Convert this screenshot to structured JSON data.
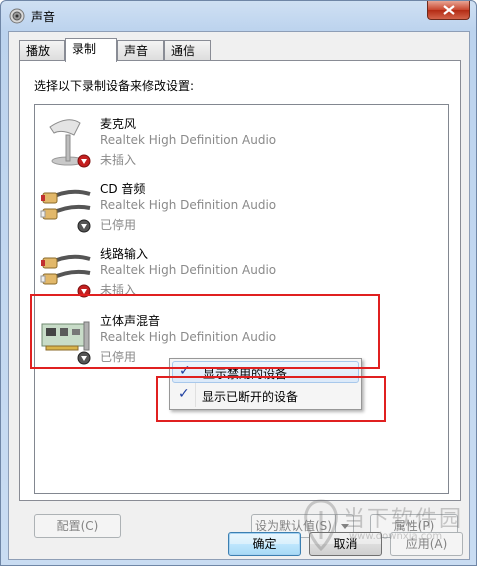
{
  "window": {
    "title": "声音"
  },
  "tabs": [
    {
      "label": "播放"
    },
    {
      "label": "录制"
    },
    {
      "label": "声音"
    },
    {
      "label": "通信"
    }
  ],
  "instruction": "选择以下录制设备来修改设置:",
  "devices": [
    {
      "name": "麦克风",
      "driver": "Realtek High Definition Audio",
      "status": "未插入",
      "icon": "microphone-icon"
    },
    {
      "name": "CD 音频",
      "driver": "Realtek High Definition Audio",
      "status": "已停用",
      "icon": "rca-jack-icon"
    },
    {
      "name": "线路输入",
      "driver": "Realtek High Definition Audio",
      "status": "未插入",
      "icon": "rca-jack-icon"
    },
    {
      "name": "立体声混音",
      "driver": "Realtek High Definition Audio",
      "status": "已停用",
      "icon": "sound-card-icon"
    }
  ],
  "context_menu": {
    "items": [
      {
        "label": "显示禁用的设备",
        "checked": true
      },
      {
        "label": "显示已断开的设备",
        "checked": true
      }
    ]
  },
  "panel_buttons": {
    "configure": "配置(C)",
    "set_default": "设为默认值(S)",
    "properties": "属性(P)"
  },
  "dialog_buttons": {
    "ok": "确定",
    "cancel": "取消",
    "apply": "应用(A)"
  },
  "watermark": {
    "main": "当下软件园",
    "sub": "www.downxia.com"
  },
  "colors": {
    "highlight_box": "#e02020",
    "disabled_text": "#8a8a8a",
    "check": "#1f3fa0"
  }
}
